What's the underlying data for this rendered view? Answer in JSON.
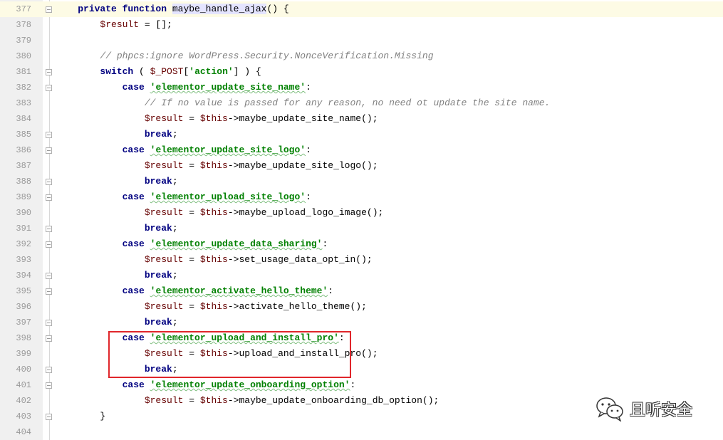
{
  "editor": {
    "lines": [
      {
        "n": "377",
        "parts": [
          {
            "t": "    "
          },
          {
            "t": "private function ",
            "c": "kw"
          },
          {
            "t": "maybe_handle_ajax",
            "c": "fn-hl"
          },
          {
            "t": "() {"
          }
        ],
        "fold": true,
        "current": true
      },
      {
        "n": "378",
        "parts": [
          {
            "t": "        "
          },
          {
            "t": "$result",
            "c": "var"
          },
          {
            "t": " = [];"
          }
        ]
      },
      {
        "n": "379",
        "parts": [
          {
            "t": ""
          }
        ]
      },
      {
        "n": "380",
        "parts": [
          {
            "t": "        "
          },
          {
            "t": "// phpcs:ignore WordPress.Security.NonceVerification.Missing",
            "c": "cm"
          }
        ]
      },
      {
        "n": "381",
        "parts": [
          {
            "t": "        "
          },
          {
            "t": "switch",
            "c": "kw"
          },
          {
            "t": " ( "
          },
          {
            "t": "$_POST",
            "c": "var"
          },
          {
            "t": "["
          },
          {
            "t": "'action'",
            "c": "str"
          },
          {
            "t": "] ) {"
          }
        ],
        "fold": true
      },
      {
        "n": "382",
        "parts": [
          {
            "t": "            "
          },
          {
            "t": "case ",
            "c": "kw"
          },
          {
            "t": "'elementor_update_site_name'",
            "c": "str squig"
          },
          {
            "t": ":"
          }
        ],
        "fold": true
      },
      {
        "n": "383",
        "parts": [
          {
            "t": "                "
          },
          {
            "t": "// If no value is passed for any reason, no need ot update the site name.",
            "c": "cm"
          }
        ]
      },
      {
        "n": "384",
        "parts": [
          {
            "t": "                "
          },
          {
            "t": "$result",
            "c": "var"
          },
          {
            "t": " = "
          },
          {
            "t": "$this",
            "c": "var"
          },
          {
            "t": "->maybe_update_site_name();"
          }
        ]
      },
      {
        "n": "385",
        "parts": [
          {
            "t": "                "
          },
          {
            "t": "break",
            "c": "kw"
          },
          {
            "t": ";"
          }
        ],
        "fold": true
      },
      {
        "n": "386",
        "parts": [
          {
            "t": "            "
          },
          {
            "t": "case ",
            "c": "kw"
          },
          {
            "t": "'elementor_update_site_logo'",
            "c": "str squig"
          },
          {
            "t": ":"
          }
        ],
        "fold": true
      },
      {
        "n": "387",
        "parts": [
          {
            "t": "                "
          },
          {
            "t": "$result",
            "c": "var"
          },
          {
            "t": " = "
          },
          {
            "t": "$this",
            "c": "var"
          },
          {
            "t": "->maybe_update_site_logo();"
          }
        ]
      },
      {
        "n": "388",
        "parts": [
          {
            "t": "                "
          },
          {
            "t": "break",
            "c": "kw"
          },
          {
            "t": ";"
          }
        ],
        "fold": true
      },
      {
        "n": "389",
        "parts": [
          {
            "t": "            "
          },
          {
            "t": "case ",
            "c": "kw"
          },
          {
            "t": "'elementor_upload_site_logo'",
            "c": "str squig"
          },
          {
            "t": ":"
          }
        ],
        "fold": true
      },
      {
        "n": "390",
        "parts": [
          {
            "t": "                "
          },
          {
            "t": "$result",
            "c": "var"
          },
          {
            "t": " = "
          },
          {
            "t": "$this",
            "c": "var"
          },
          {
            "t": "->maybe_upload_logo_image();"
          }
        ]
      },
      {
        "n": "391",
        "parts": [
          {
            "t": "                "
          },
          {
            "t": "break",
            "c": "kw"
          },
          {
            "t": ";"
          }
        ],
        "fold": true
      },
      {
        "n": "392",
        "parts": [
          {
            "t": "            "
          },
          {
            "t": "case ",
            "c": "kw"
          },
          {
            "t": "'elementor_update_data_sharing'",
            "c": "str squig"
          },
          {
            "t": ":"
          }
        ],
        "fold": true
      },
      {
        "n": "393",
        "parts": [
          {
            "t": "                "
          },
          {
            "t": "$result",
            "c": "var"
          },
          {
            "t": " = "
          },
          {
            "t": "$this",
            "c": "var"
          },
          {
            "t": "->set_usage_data_opt_in();"
          }
        ]
      },
      {
        "n": "394",
        "parts": [
          {
            "t": "                "
          },
          {
            "t": "break",
            "c": "kw"
          },
          {
            "t": ";"
          }
        ],
        "fold": true
      },
      {
        "n": "395",
        "parts": [
          {
            "t": "            "
          },
          {
            "t": "case ",
            "c": "kw"
          },
          {
            "t": "'elementor_activate_hello_theme'",
            "c": "str squig"
          },
          {
            "t": ":"
          }
        ],
        "fold": true
      },
      {
        "n": "396",
        "parts": [
          {
            "t": "                "
          },
          {
            "t": "$result",
            "c": "var"
          },
          {
            "t": " = "
          },
          {
            "t": "$this",
            "c": "var"
          },
          {
            "t": "->activate_hello_theme();"
          }
        ]
      },
      {
        "n": "397",
        "parts": [
          {
            "t": "                "
          },
          {
            "t": "break",
            "c": "kw"
          },
          {
            "t": ";"
          }
        ],
        "fold": true
      },
      {
        "n": "398",
        "parts": [
          {
            "t": "            "
          },
          {
            "t": "case ",
            "c": "kw"
          },
          {
            "t": "'elementor_upload_and_install_pro'",
            "c": "str squig"
          },
          {
            "t": ":"
          }
        ],
        "fold": true
      },
      {
        "n": "399",
        "parts": [
          {
            "t": "                "
          },
          {
            "t": "$result",
            "c": "var"
          },
          {
            "t": " = "
          },
          {
            "t": "$this",
            "c": "var"
          },
          {
            "t": "->upload_and_install_pro();"
          }
        ]
      },
      {
        "n": "400",
        "parts": [
          {
            "t": "                "
          },
          {
            "t": "break",
            "c": "kw"
          },
          {
            "t": ";"
          }
        ],
        "fold": true
      },
      {
        "n": "401",
        "parts": [
          {
            "t": "            "
          },
          {
            "t": "case ",
            "c": "kw"
          },
          {
            "t": "'elementor_update_onboarding_option'",
            "c": "str squig"
          },
          {
            "t": ":"
          }
        ],
        "fold": true
      },
      {
        "n": "402",
        "parts": [
          {
            "t": "                "
          },
          {
            "t": "$result",
            "c": "var"
          },
          {
            "t": " = "
          },
          {
            "t": "$this",
            "c": "var"
          },
          {
            "t": "->maybe_update_onboarding_db_option();"
          }
        ]
      },
      {
        "n": "403",
        "parts": [
          {
            "t": "        }"
          }
        ],
        "fold": true
      },
      {
        "n": "404",
        "parts": [
          {
            "t": ""
          }
        ]
      }
    ]
  },
  "watermark": {
    "text": "且听安全",
    "icon": "wechat-icon"
  },
  "colors": {
    "highlight_border": "#e0262b",
    "keyword": "#000080",
    "string": "#008000",
    "variable": "#660000",
    "comment": "#808080"
  }
}
